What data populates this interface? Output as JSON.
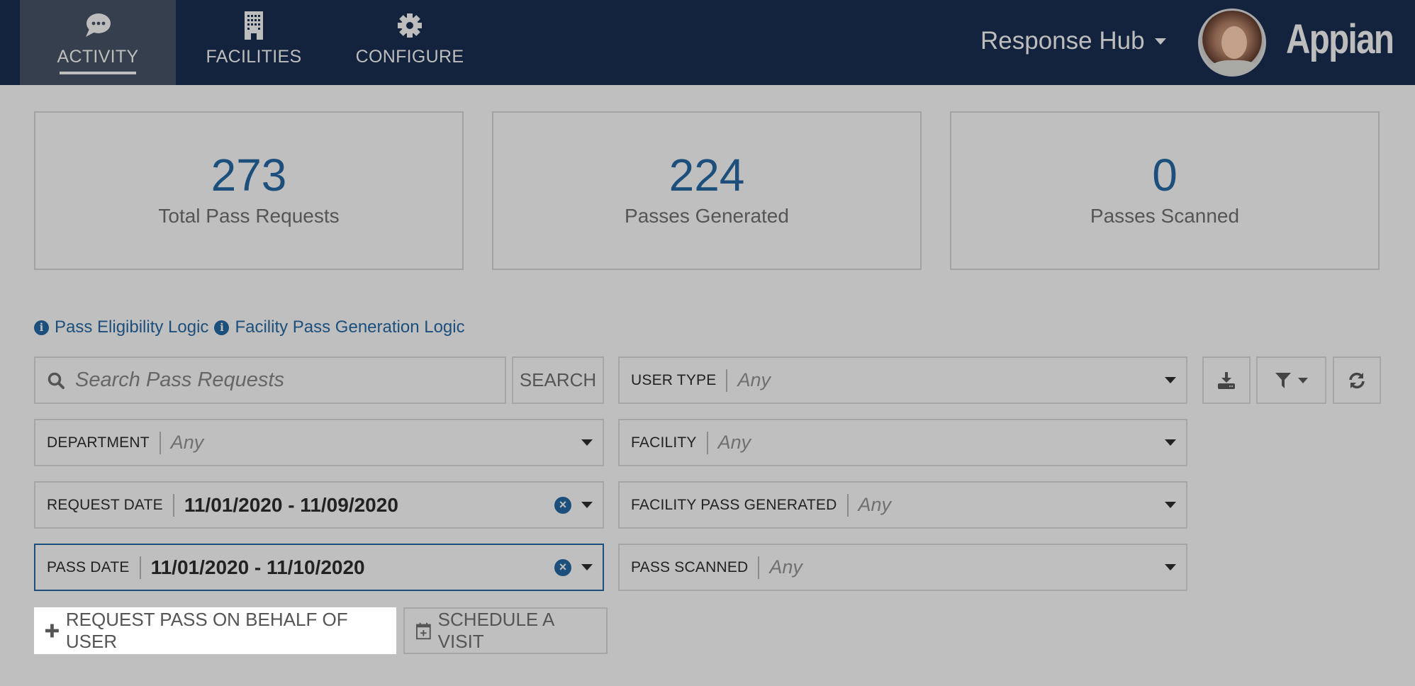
{
  "header": {
    "nav_tabs": [
      {
        "label": "ACTIVITY",
        "icon": "chat-bubble-icon",
        "active": true
      },
      {
        "label": "FACILITIES",
        "icon": "building-icon",
        "active": false
      },
      {
        "label": "CONFIGURE",
        "icon": "gear-icon",
        "active": false
      }
    ],
    "site_name": "Response Hub",
    "logo_text": "Appian",
    "colors": {
      "bar": "#13233d",
      "active_tab": "#353f4d"
    }
  },
  "kpis": [
    {
      "value": "273",
      "caption": "Total Pass Requests"
    },
    {
      "value": "224",
      "caption": "Passes Generated"
    },
    {
      "value": "0",
      "caption": "Passes Scanned"
    }
  ],
  "links": [
    {
      "label": "Pass Eligibility Logic",
      "icon": "info-icon"
    },
    {
      "label": "Facility Pass Generation Logic",
      "icon": "info-icon"
    }
  ],
  "search": {
    "placeholder": "Search Pass Requests",
    "button_label": "SEARCH"
  },
  "filters": {
    "department": {
      "label": "DEPARTMENT",
      "value": "Any"
    },
    "request_date": {
      "label": "REQUEST DATE",
      "value": "11/01/2020 - 11/09/2020"
    },
    "pass_date": {
      "label": "PASS DATE",
      "value": "11/01/2020 - 11/10/2020"
    },
    "user_type": {
      "label": "USER TYPE",
      "value": "Any"
    },
    "facility": {
      "label": "FACILITY",
      "value": "Any"
    },
    "facility_pass_generated": {
      "label": "FACILITY PASS GENERATED",
      "value": "Any"
    },
    "pass_scanned": {
      "label": "PASS SCANNED",
      "value": "Any"
    }
  },
  "toolbar": {
    "icons": [
      "download-icon",
      "filter-icon",
      "refresh-icon"
    ]
  },
  "actions": {
    "request_pass": "REQUEST PASS ON BEHALF OF USER",
    "schedule_visit": "SCHEDULE A VISIT"
  },
  "accent_color": "#1c4f7c"
}
